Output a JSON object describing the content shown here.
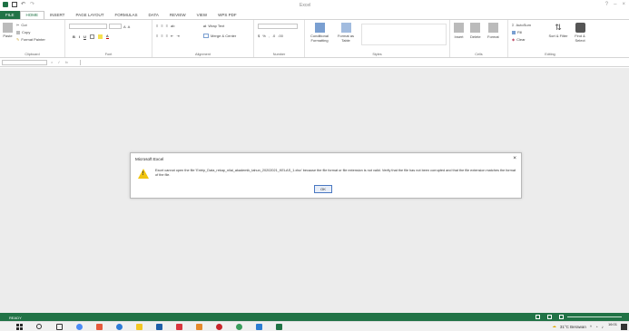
{
  "window": {
    "title": "Excel"
  },
  "tabs": [
    "FILE",
    "HOME",
    "INSERT",
    "PAGE LAYOUT",
    "FORMULAS",
    "DATA",
    "REVIEW",
    "VIEW",
    "WPS PDF"
  ],
  "ribbon": {
    "clipboard": {
      "label": "Clipboard",
      "paste": "Paste",
      "cut": "Cut",
      "copy": "Copy",
      "format_painter": "Format Painter"
    },
    "font": {
      "label": "Font"
    },
    "alignment": {
      "label": "Alignment",
      "wrap_text": "Wrap Text",
      "merge_center": "Merge & Center"
    },
    "number": {
      "label": "Number"
    },
    "styles": {
      "label": "Styles",
      "conditional_formatting": "Conditional Formatting",
      "format_as_table": "Format as Table"
    },
    "cells": {
      "label": "Cells",
      "insert": "Insert",
      "delete": "Delete",
      "format": "Format"
    },
    "editing": {
      "label": "Editing",
      "autosum": "AutoSum",
      "fill": "Fill",
      "clear": "Clear",
      "sort_filter": "Sort & Filter",
      "find_select": "Find & Select"
    }
  },
  "formula_bar": {
    "fx": "fx"
  },
  "dialog": {
    "title": "Microsoft Excel",
    "message": "Excel cannot open the file 'Entrip_Data_rekap_nilai_akademik_tahun_20202021_KELAS_1.xlsx' because the file format or file extension is not valid. Verify that the file has not been corrupted and that the file extension matches the format of the file.",
    "ok_label": "OK"
  },
  "status": {
    "ready": "READY"
  },
  "taskbar": {
    "weather": "31°C Berawan",
    "time": "16:01"
  },
  "colors": {
    "excel_green": "#217346",
    "workspace_gray": "#ececec",
    "warning_yellow": "#f1c40f"
  }
}
